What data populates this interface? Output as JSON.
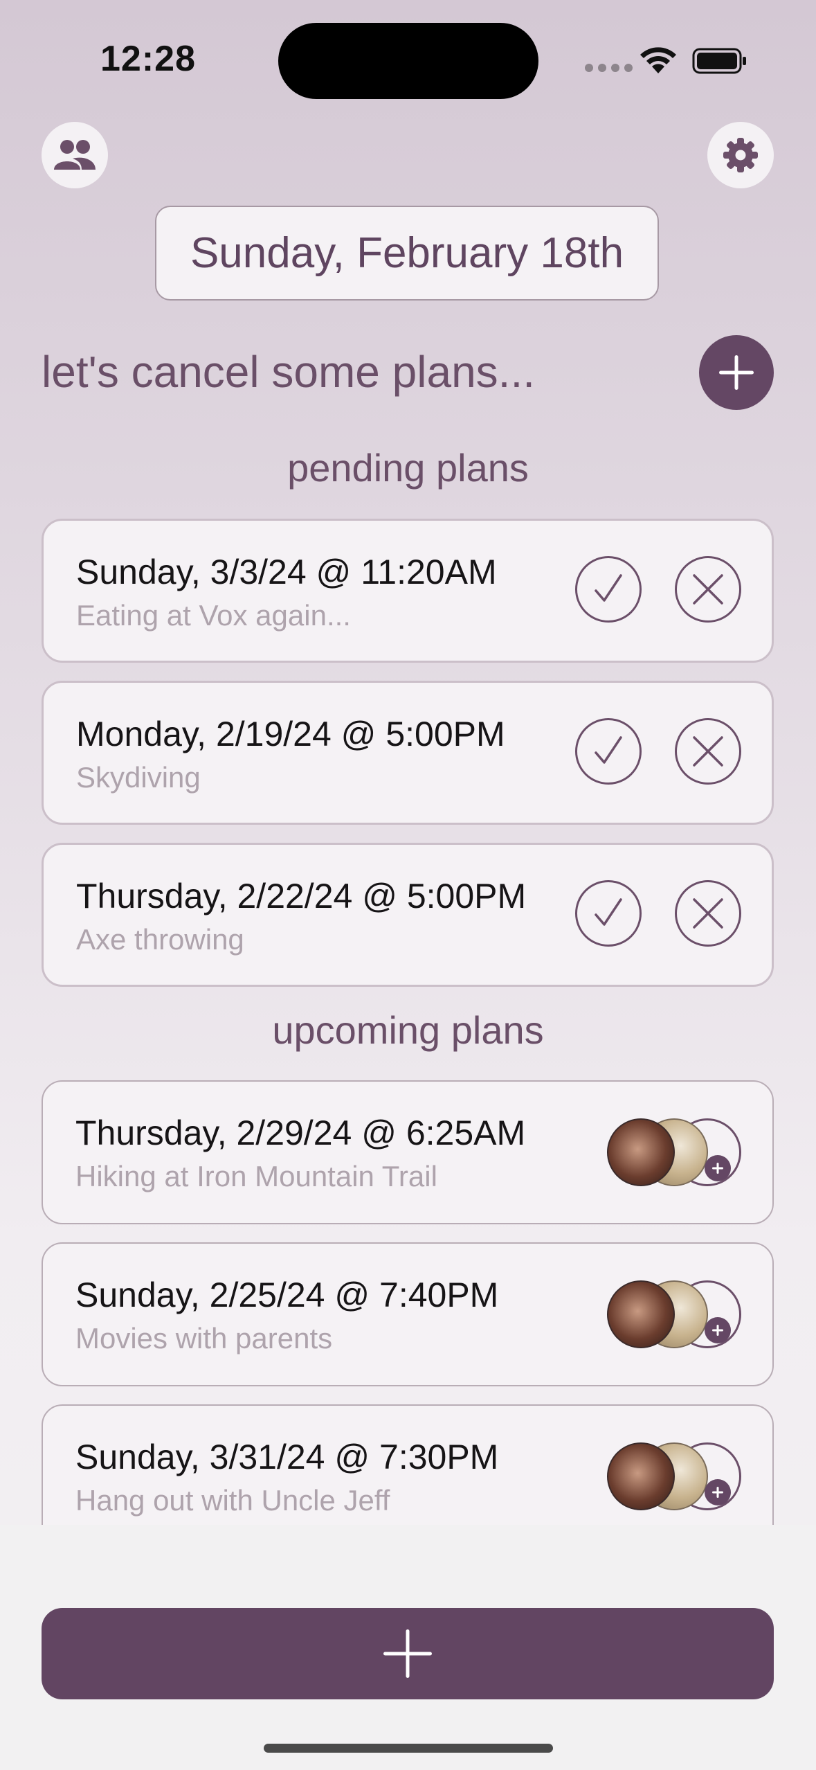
{
  "status_bar": {
    "time": "12:28",
    "wifi_icon": "wifi-icon",
    "battery_icon": "battery-icon"
  },
  "header": {
    "friends_icon": "people-icon",
    "settings_icon": "gear-icon",
    "date": "Sunday, February 18th",
    "headline": "let's cancel some plans...",
    "add_icon": "plus-icon"
  },
  "pending": {
    "title": "pending plans",
    "items": [
      {
        "title": "Sunday, 3/3/24 @ 11:20AM",
        "subtitle": "Eating at Vox again..."
      },
      {
        "title": "Monday, 2/19/24 @ 5:00PM",
        "subtitle": "Skydiving"
      },
      {
        "title": "Thursday, 2/22/24 @ 5:00PM",
        "subtitle": "Axe throwing"
      }
    ]
  },
  "upcoming": {
    "title": "upcoming plans",
    "items": [
      {
        "title": "Thursday, 2/29/24 @ 6:25AM",
        "subtitle": "Hiking at Iron Mountain Trail"
      },
      {
        "title": "Sunday, 2/25/24 @ 7:40PM",
        "subtitle": "Movies with parents"
      },
      {
        "title": "Sunday, 3/31/24 @ 7:30PM",
        "subtitle": "Hang out with Uncle Jeff"
      }
    ]
  },
  "colors": {
    "accent": "#644764",
    "card_bg": "#f5f2f5",
    "text_muted": "#aea3ac"
  }
}
